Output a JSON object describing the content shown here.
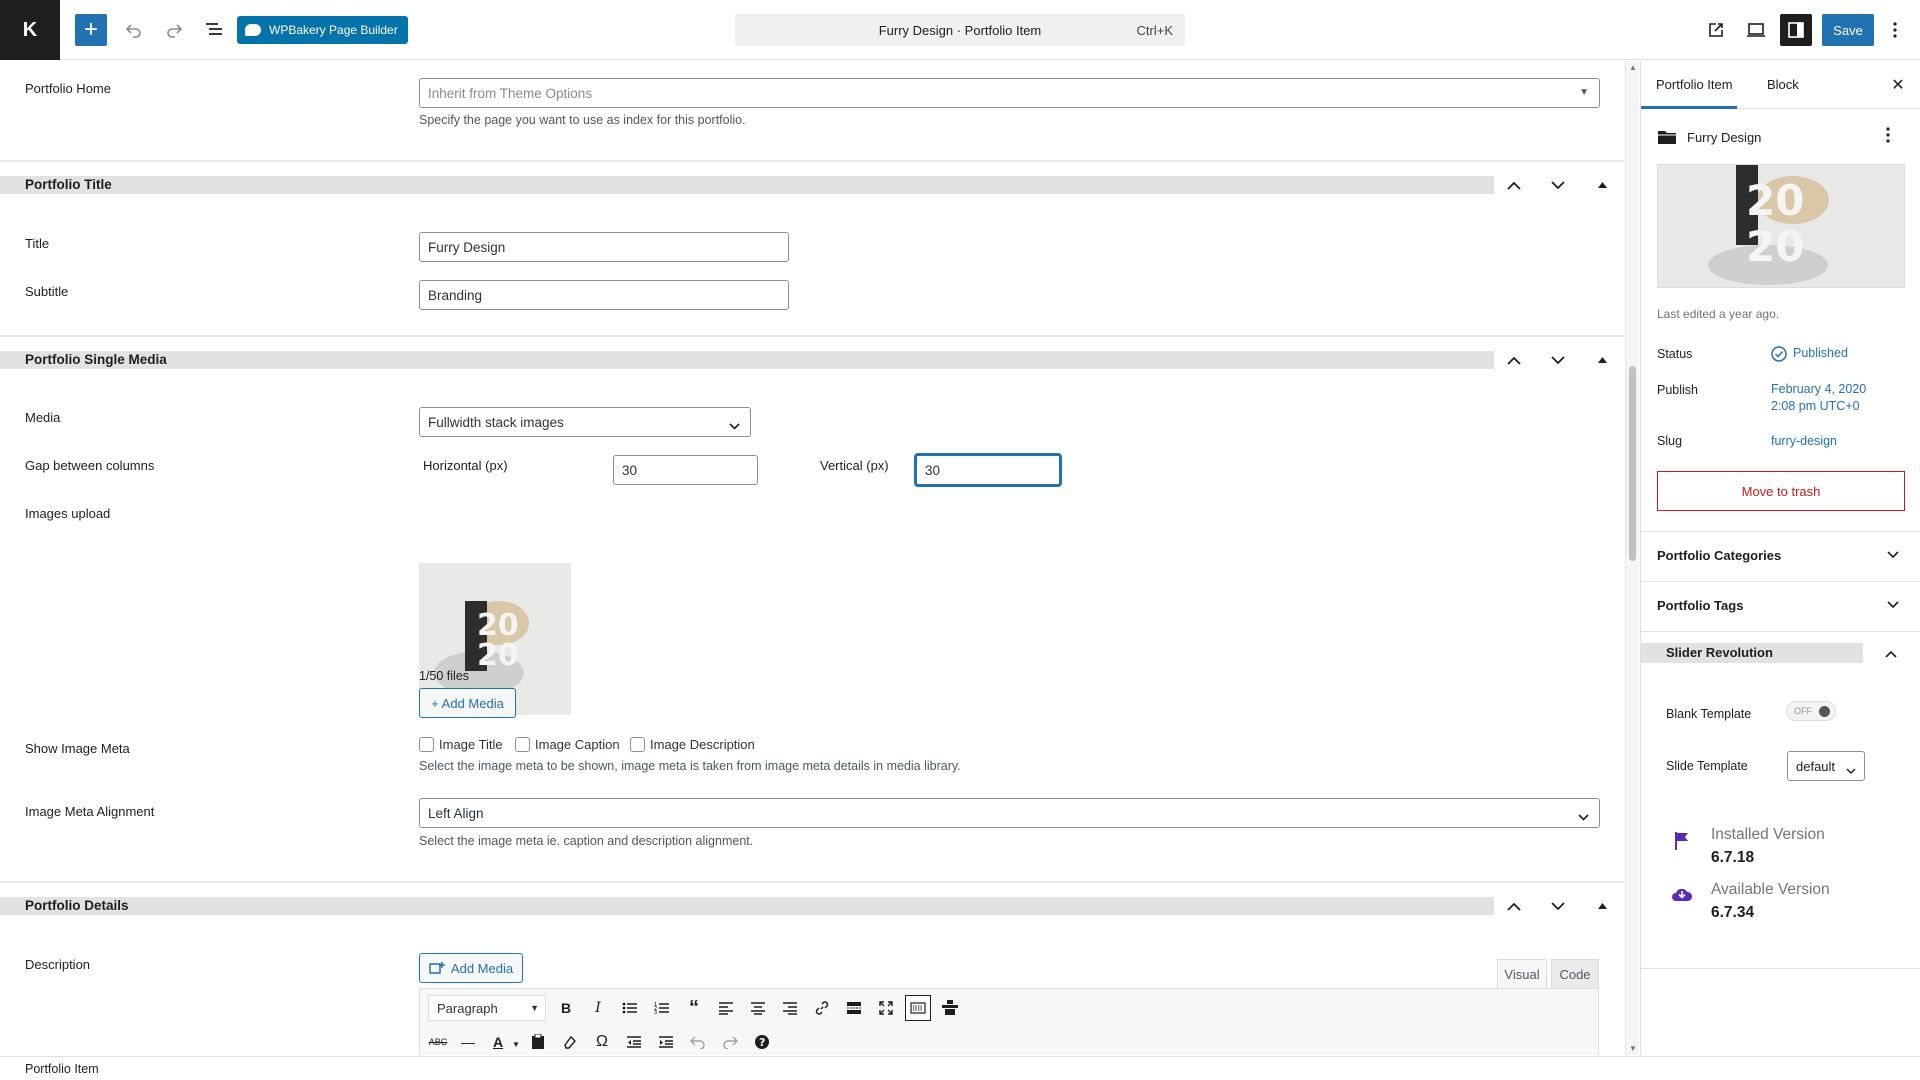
{
  "topbar": {
    "logo": "K",
    "page_builder": "WPBakery Page Builder",
    "command_title": "Furry Design · Portfolio Item",
    "command_shortcut": "Ctrl+K",
    "save": "Save"
  },
  "portfolio_home": {
    "label": "Portfolio Home",
    "placeholder": "Inherit from Theme Options",
    "description": "Specify the page you want to use as index for this portfolio."
  },
  "sections": {
    "title_section": "Portfolio Title",
    "media_section": "Portfolio Single Media",
    "details_section": "Portfolio Details"
  },
  "title_fields": {
    "title_label": "Title",
    "title_value": "Furry Design",
    "subtitle_label": "Subtitle",
    "subtitle_value": "Branding"
  },
  "media": {
    "media_label": "Media",
    "media_value": "Fullwidth stack images",
    "gap_label": "Gap between columns",
    "horizontal_label": "Horizontal (px)",
    "horizontal_value": "30",
    "vertical_label": "Vertical (px)",
    "vertical_value": "30",
    "upload_label": "Images upload",
    "files_count": "1/50 files",
    "add_media": "+ Add Media",
    "meta_label": "Show Image Meta",
    "meta_options": [
      "Image Title",
      "Image Caption",
      "Image Description"
    ],
    "meta_description": "Select the image meta to be shown, image meta is taken from image meta details in media library.",
    "align_label": "Image Meta Alignment",
    "align_value": "Left Align",
    "align_description": "Select the image meta ie. caption and description alignment."
  },
  "details": {
    "description_label": "Description",
    "add_media": "Add Media",
    "tab_visual": "Visual",
    "tab_code": "Code",
    "format_value": "Paragraph"
  },
  "sidebar": {
    "tab_portfolio": "Portfolio Item",
    "tab_block": "Block",
    "post_title": "Furry Design",
    "last_edited": "Last edited a year ago.",
    "status_label": "Status",
    "status_value": "Published",
    "publish_label": "Publish",
    "publish_date": "February 4, 2020",
    "publish_time": "2:08 pm UTC+0",
    "slug_label": "Slug",
    "slug_value": "furry-design",
    "trash": "Move to trash",
    "categories": "Portfolio Categories",
    "tags": "Portfolio Tags",
    "slider_revolution": "Slider Revolution",
    "blank_template_label": "Blank Template",
    "toggle_state": "OFF",
    "slide_template_label": "Slide Template",
    "slide_template_value": "default",
    "installed_label": "Installed Version",
    "installed_value": "6.7.18",
    "available_label": "Available Version",
    "available_value": "6.7.34"
  },
  "footer": {
    "breadcrumb": "Portfolio Item"
  },
  "colors": {
    "accent": "#2271b1",
    "danger": "#cc1818",
    "flag": "#5b2bb5"
  }
}
